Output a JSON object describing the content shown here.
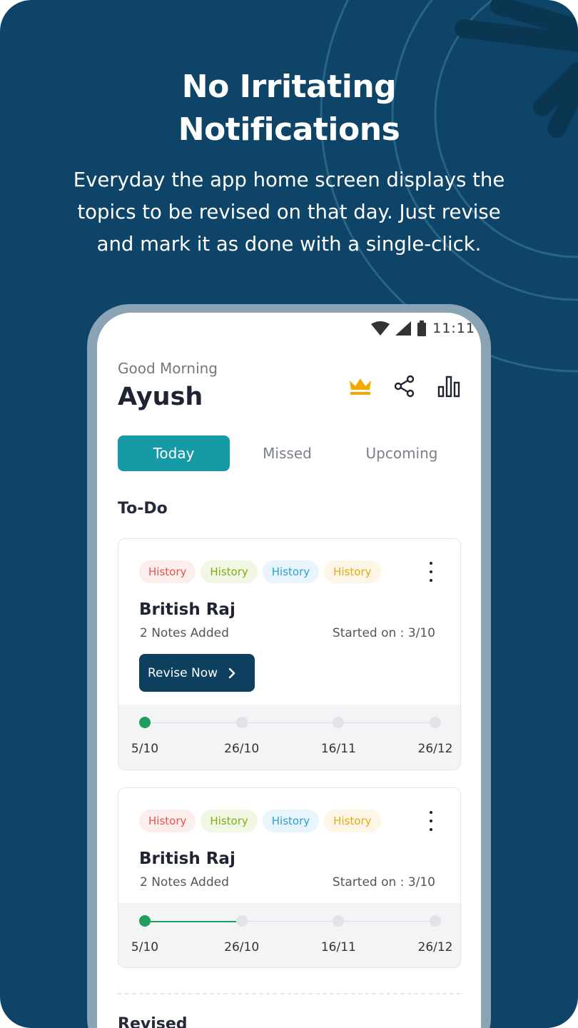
{
  "colors": {
    "background": "#0d4467",
    "accent_teal": "#159aa6",
    "button_dark": "#0d3f5f",
    "progress_green": "#1f9e5d",
    "crown_gold": "#f2a900"
  },
  "headline": {
    "line1": "No Irritating",
    "line2": "Notifications"
  },
  "subhead": {
    "line1": "Everyday the app home screen displays the",
    "line2": "topics to be revised on that day. Just revise",
    "line3": "and mark it as done with a single-click."
  },
  "status_bar": {
    "time": "11:11",
    "icons": [
      "wifi-icon",
      "signal-icon",
      "battery-icon"
    ]
  },
  "header": {
    "greeting": "Good Morning",
    "name": "Ayush",
    "icons": [
      "crown-icon",
      "share-icon",
      "stats-icon"
    ]
  },
  "tabs": [
    {
      "label": "Today",
      "active": true
    },
    {
      "label": "Missed",
      "active": false
    },
    {
      "label": "Upcoming",
      "active": false
    }
  ],
  "todo": {
    "title": "To-Do",
    "cards": [
      {
        "tags": [
          {
            "label": "History",
            "color": "#e5534b",
            "bg": "#fdeeee"
          },
          {
            "label": "History",
            "color": "#7fae1c",
            "bg": "#f0f7e3"
          },
          {
            "label": "History",
            "color": "#2a9fd6",
            "bg": "#e8f5fc"
          },
          {
            "label": "History",
            "color": "#e6a817",
            "bg": "#fdf6e6"
          }
        ],
        "title": "British Raj",
        "notes": "2 Notes Added",
        "started": "Started on : 3/10",
        "button": "Revise Now",
        "progress_fraction": 0,
        "timeline": [
          "5/10",
          "26/10",
          "16/11",
          "26/12"
        ]
      },
      {
        "tags": [
          {
            "label": "History",
            "color": "#e5534b",
            "bg": "#fdeeee"
          },
          {
            "label": "History",
            "color": "#7fae1c",
            "bg": "#f0f7e3"
          },
          {
            "label": "History",
            "color": "#2a9fd6",
            "bg": "#e8f5fc"
          },
          {
            "label": "History",
            "color": "#e6a817",
            "bg": "#fdf6e6"
          }
        ],
        "title": "British Raj",
        "notes": "2 Notes Added",
        "started": "Started on : 3/10",
        "progress_fraction": 0.33,
        "timeline": [
          "5/10",
          "26/10",
          "16/11",
          "26/12"
        ]
      }
    ]
  },
  "revised": {
    "title": "Revised"
  }
}
